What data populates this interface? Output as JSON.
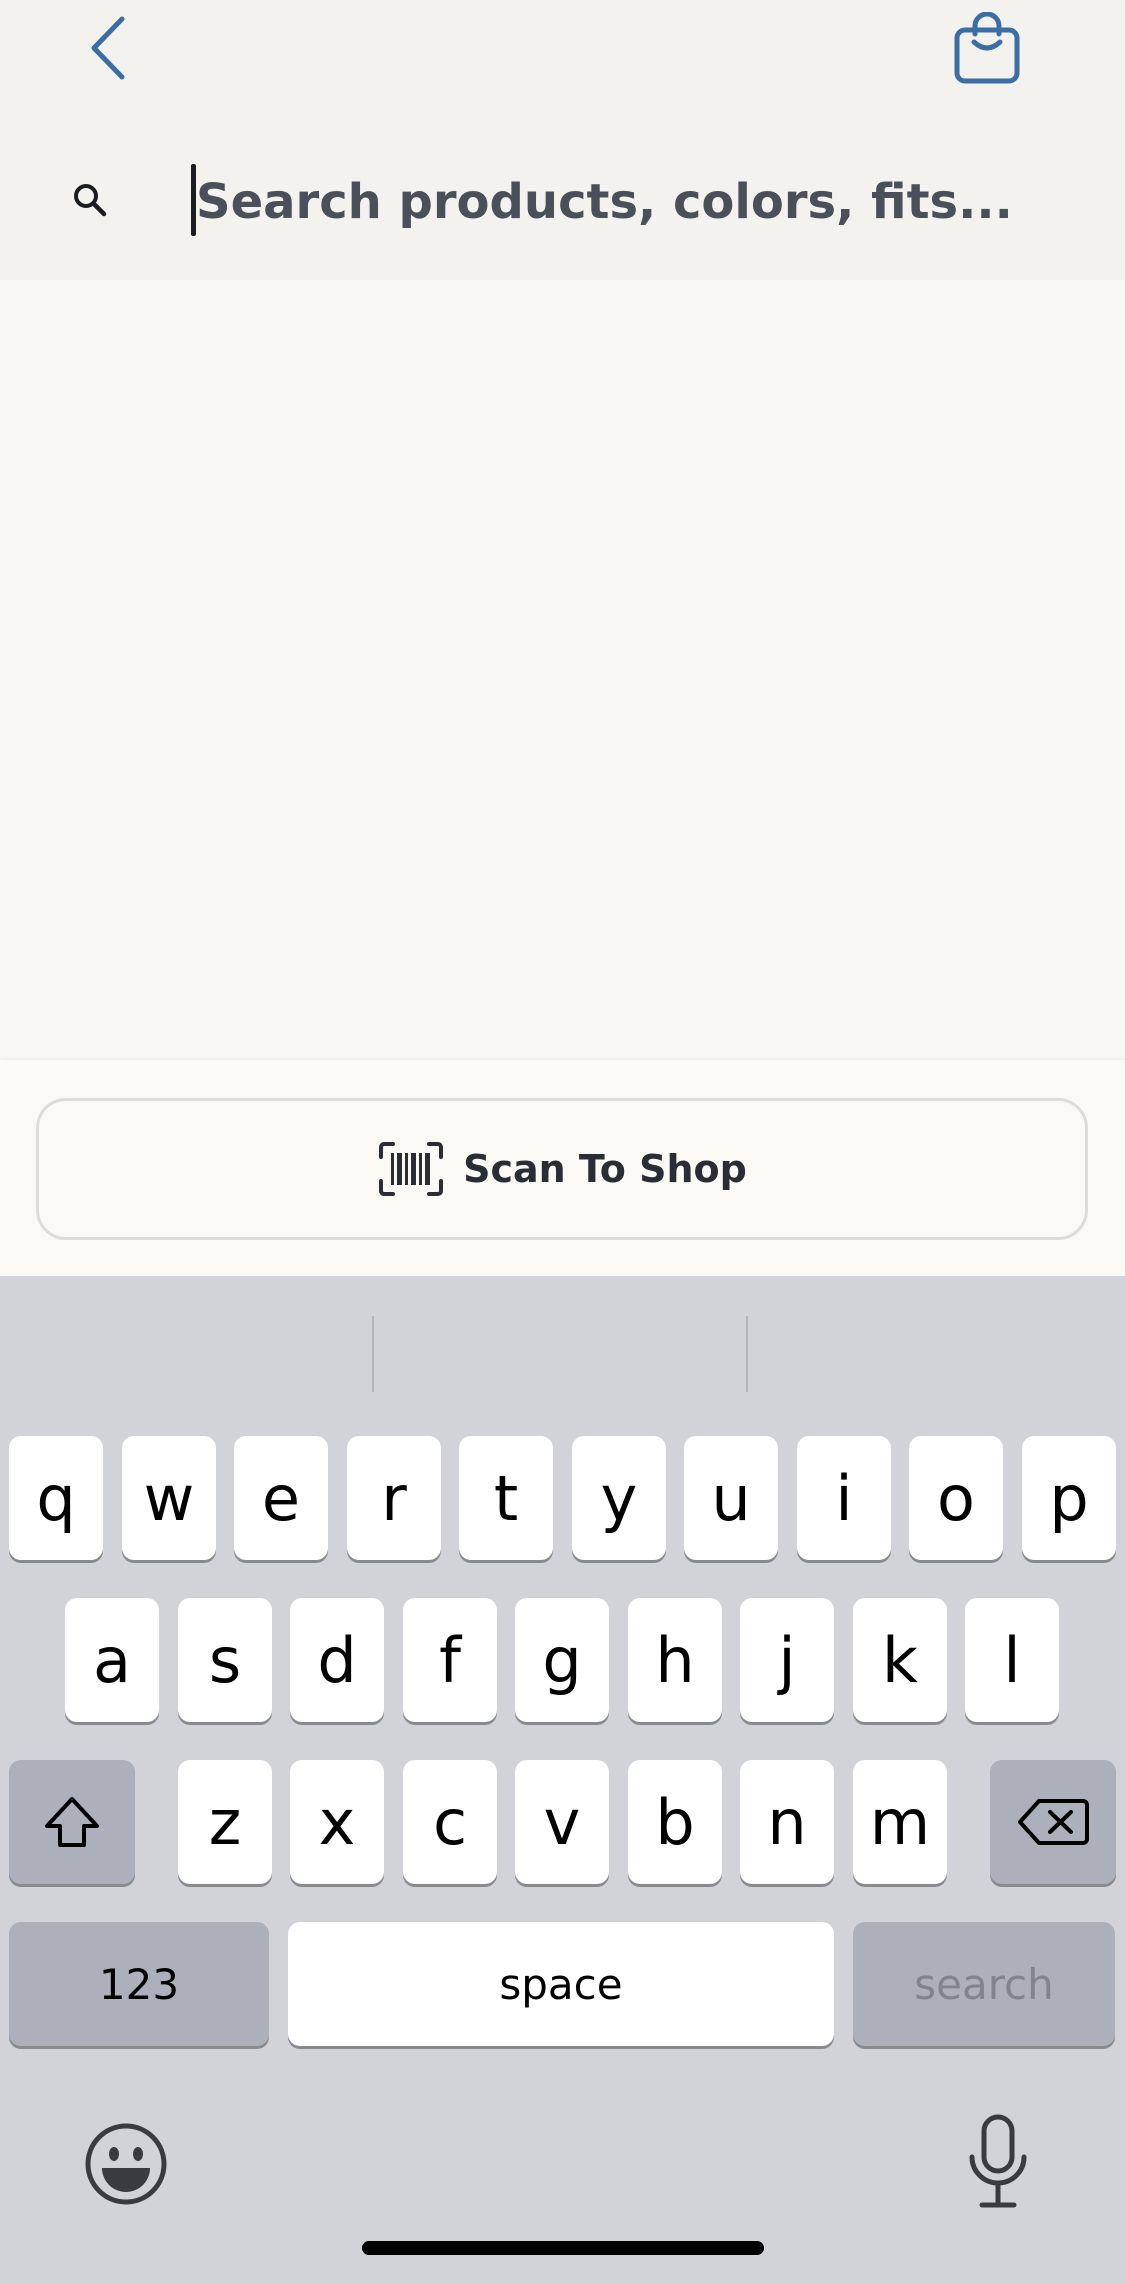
{
  "header": {
    "back_icon": "chevron-left-icon",
    "bag_icon": "shopping-bag-icon",
    "search": {
      "placeholder": "Search products, colors, fits...",
      "value": "",
      "icon": "search-icon"
    }
  },
  "scan": {
    "label": "Scan To Shop",
    "icon": "barcode-icon"
  },
  "keyboard": {
    "row1": [
      "q",
      "w",
      "e",
      "r",
      "t",
      "y",
      "u",
      "i",
      "o",
      "p"
    ],
    "row2": [
      "a",
      "s",
      "d",
      "f",
      "g",
      "h",
      "j",
      "k",
      "l"
    ],
    "row3": [
      "z",
      "x",
      "c",
      "v",
      "b",
      "n",
      "m"
    ],
    "shift_icon": "shift-icon",
    "delete_icon": "backspace-icon",
    "numbers_label": "123",
    "space_label": "space",
    "search_label": "search",
    "emoji_icon": "emoji-icon",
    "mic_icon": "microphone-icon"
  },
  "colors": {
    "accent": "#3b6ea5",
    "keyboard_bg": "#d1d3d9",
    "key_dark": "#abb0ba"
  }
}
